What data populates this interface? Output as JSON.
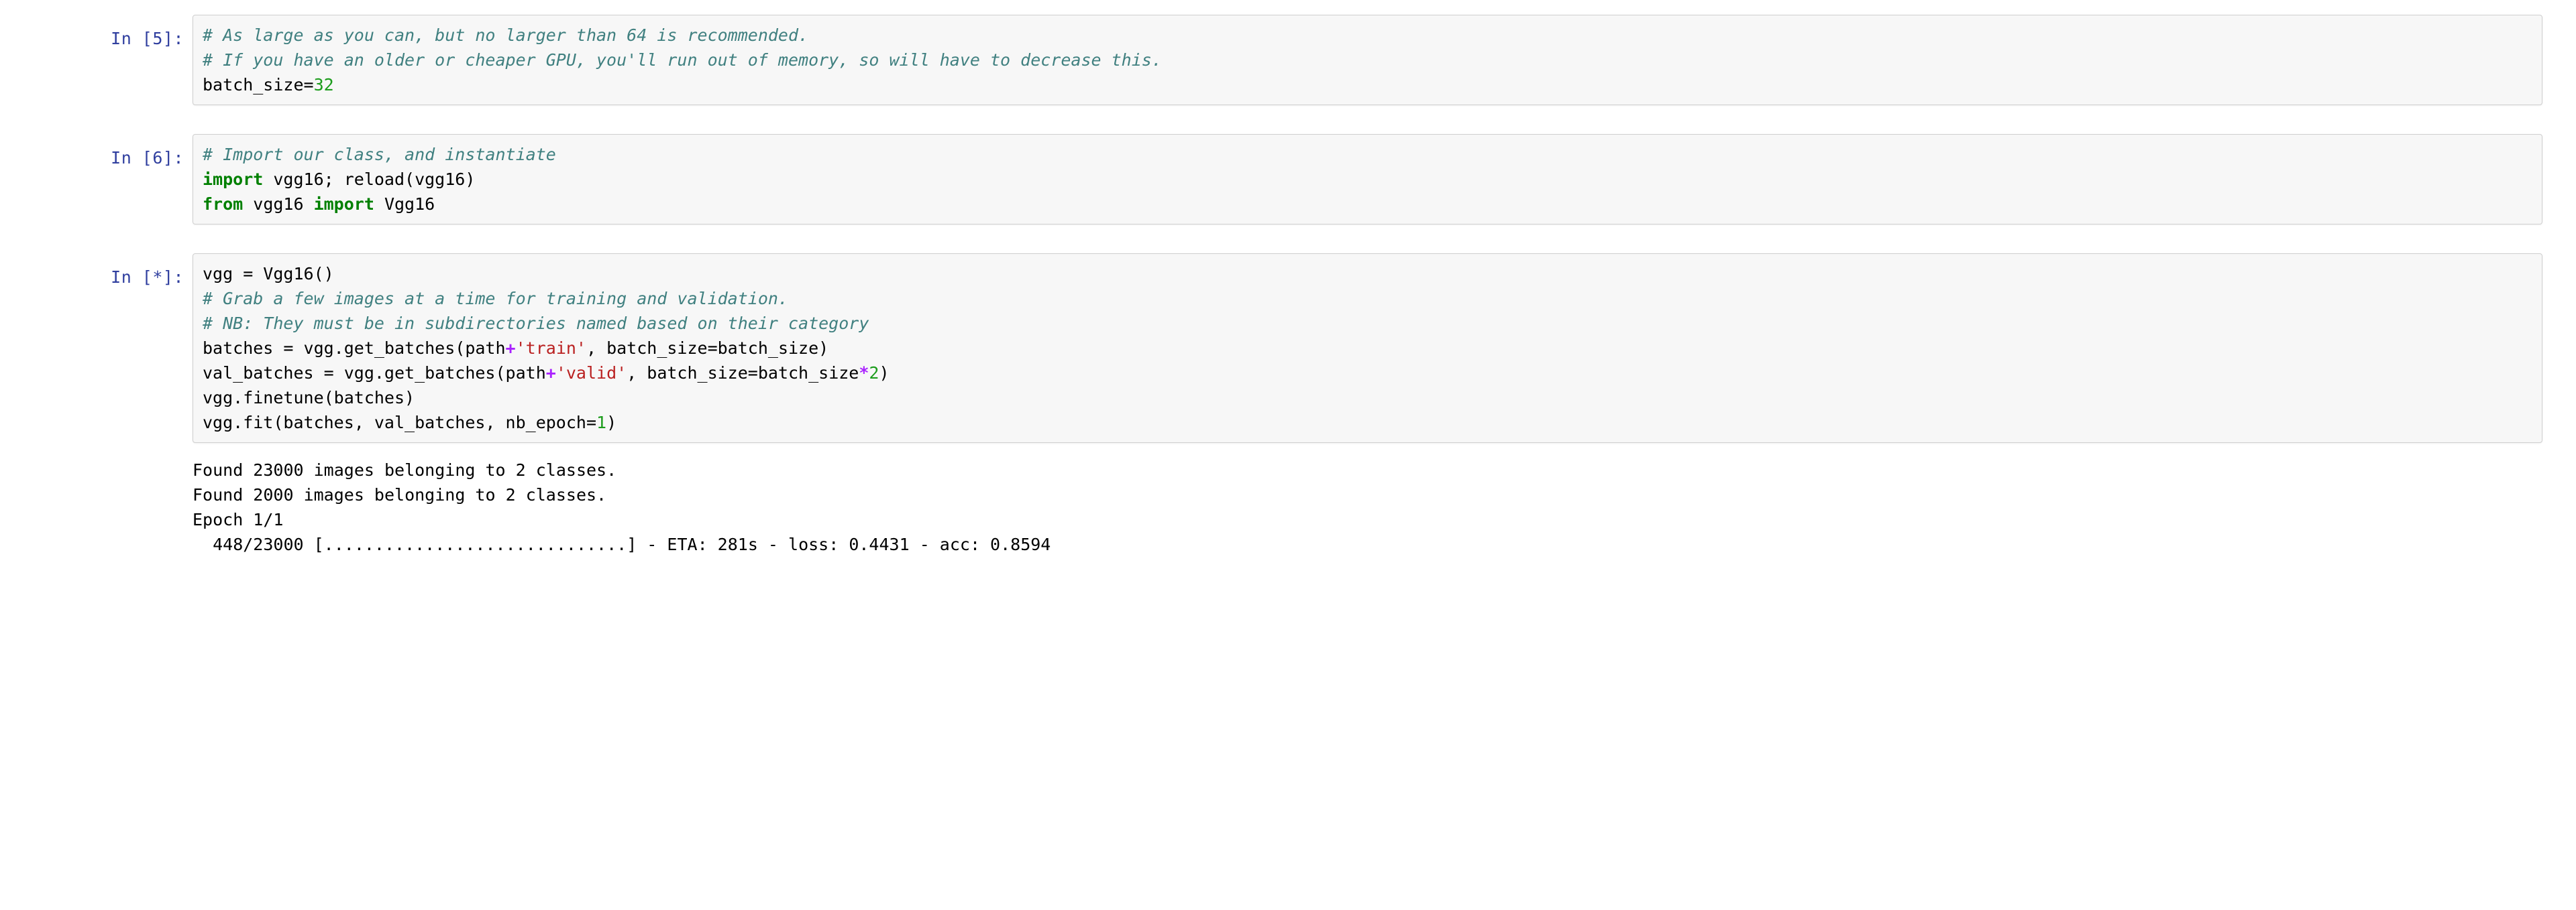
{
  "notebook": {
    "cells": [
      {
        "prompt": "In [5]:",
        "lines": [
          {
            "tokens": [
              {
                "t": "comment",
                "s": "# As large as you can, but no larger than 64 is recommended."
              }
            ]
          },
          {
            "tokens": [
              {
                "t": "comment",
                "s": "# If you have an older or cheaper GPU, you'll run out of memory, so will have to decrease this."
              }
            ]
          },
          {
            "tokens": [
              {
                "t": "plain",
                "s": "batch_size="
              },
              {
                "t": "number",
                "s": "32"
              }
            ]
          }
        ]
      },
      {
        "prompt": "In [6]:",
        "lines": [
          {
            "tokens": [
              {
                "t": "comment",
                "s": "# Import our class, and instantiate"
              }
            ]
          },
          {
            "tokens": [
              {
                "t": "keyword",
                "s": "import"
              },
              {
                "t": "plain",
                "s": " vgg16; reload(vgg16)"
              }
            ]
          },
          {
            "tokens": [
              {
                "t": "keyword",
                "s": "from"
              },
              {
                "t": "plain",
                "s": " vgg16 "
              },
              {
                "t": "keyword",
                "s": "import"
              },
              {
                "t": "plain",
                "s": " Vgg16"
              }
            ]
          }
        ]
      },
      {
        "prompt": "In [*]:",
        "lines": [
          {
            "tokens": [
              {
                "t": "plain",
                "s": "vgg = Vgg16()"
              }
            ]
          },
          {
            "tokens": [
              {
                "t": "comment",
                "s": "# Grab a few images at a time for training and validation."
              }
            ]
          },
          {
            "tokens": [
              {
                "t": "comment",
                "s": "# NB: They must be in subdirectories named based on their category"
              }
            ]
          },
          {
            "tokens": [
              {
                "t": "plain",
                "s": "batches = vgg.get_batches(path"
              },
              {
                "t": "op",
                "s": "+"
              },
              {
                "t": "string",
                "s": "'train'"
              },
              {
                "t": "plain",
                "s": ", batch_size=batch_size)"
              }
            ]
          },
          {
            "tokens": [
              {
                "t": "plain",
                "s": "val_batches = vgg.get_batches(path"
              },
              {
                "t": "op",
                "s": "+"
              },
              {
                "t": "string",
                "s": "'valid'"
              },
              {
                "t": "plain",
                "s": ", batch_size=batch_size"
              },
              {
                "t": "op",
                "s": "*"
              },
              {
                "t": "number",
                "s": "2"
              },
              {
                "t": "plain",
                "s": ")"
              }
            ]
          },
          {
            "tokens": [
              {
                "t": "plain",
                "s": "vgg.finetune(batches)"
              }
            ]
          },
          {
            "tokens": [
              {
                "t": "plain",
                "s": "vgg.fit(batches, val_batches, nb_epoch="
              },
              {
                "t": "number",
                "s": "1"
              },
              {
                "t": "plain",
                "s": ")"
              }
            ]
          }
        ],
        "output": [
          "Found 23000 images belonging to 2 classes.",
          "Found 2000 images belonging to 2 classes.",
          "Epoch 1/1",
          "  448/23000 [..............................] - ETA: 281s - loss: 0.4431 - acc: 0.8594"
        ]
      }
    ]
  },
  "training": {
    "found_train_images": 23000,
    "found_valid_images": 2000,
    "num_classes": 2,
    "epoch_current": 1,
    "epoch_total": 1,
    "samples_seen": 448,
    "samples_total": 23000,
    "eta_seconds": 281,
    "loss": 0.4431,
    "accuracy": 0.8594,
    "batch_size": 32
  },
  "colors": {
    "prompt": "#303F9F",
    "comment": "#408080",
    "keyword": "#008000",
    "string": "#BA2121",
    "number": "#1C9C1C",
    "operator": "#AA22FF",
    "cell_background": "#f7f7f7",
    "cell_border": "#cfcfcf",
    "page_background": "#ffffff"
  }
}
